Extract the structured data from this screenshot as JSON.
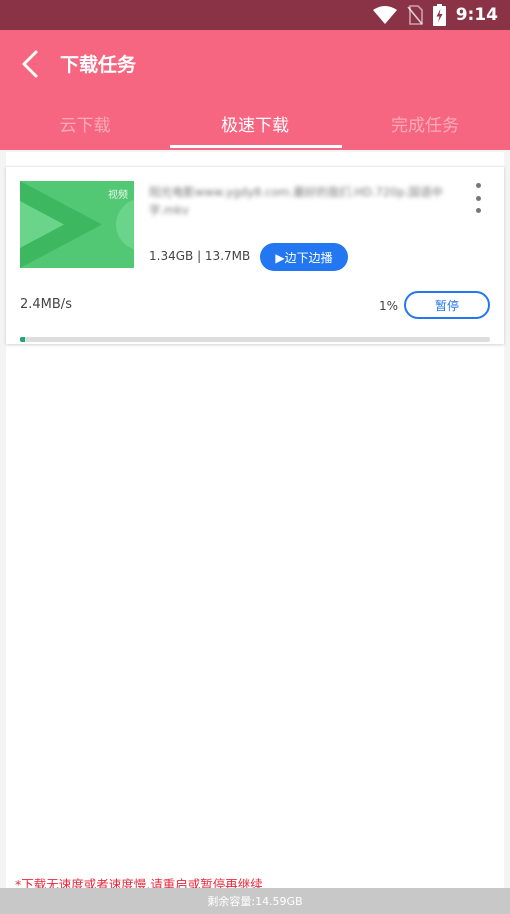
{
  "status_bar": {
    "time": "9:14",
    "icons": [
      "wifi-icon",
      "no-sim-icon",
      "battery-charging-icon"
    ]
  },
  "header": {
    "title": "下载任务",
    "back_icon": "chevron-left-icon"
  },
  "tabs": [
    {
      "label": "云下载",
      "active": false
    },
    {
      "label": "极速下载",
      "active": true
    },
    {
      "label": "完成任务",
      "active": false
    }
  ],
  "task": {
    "thumb_tag": "视频",
    "file_name": "阳光电影www.ygdy8.com.最好的我们.HD.720p.国语中字.mkv",
    "size_text": "1.34GB | 13.7MB",
    "play_label": "▶边下边播",
    "speed": "2.4MB/s",
    "percent_text": "1%",
    "progress": 0.01,
    "pause_label": "暂停"
  },
  "hint": "*下载无速度或者速度慢,请重启或暂停再继续",
  "footer": {
    "storage_text": "剩余容量:14.59GB"
  },
  "colors": {
    "header": "#f76680",
    "status_bar": "#8a3347",
    "accent_blue": "#2377f0",
    "progress": "#1fa876",
    "thumb": "#52c874",
    "hint": "#e8283b"
  }
}
